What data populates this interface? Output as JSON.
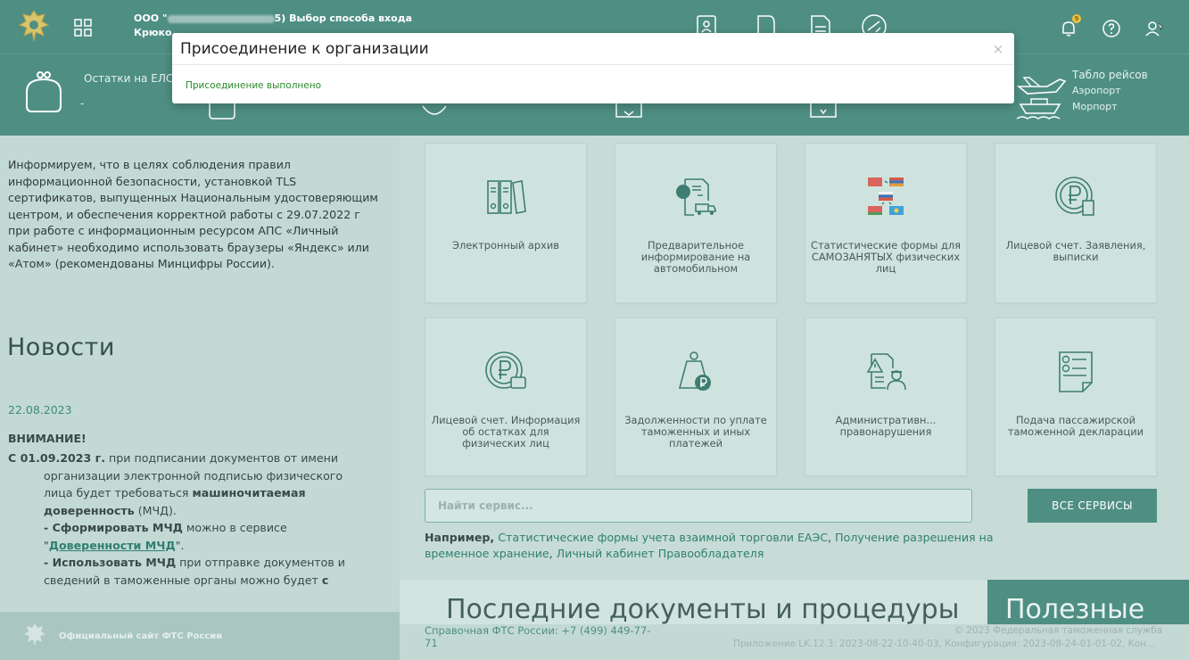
{
  "header": {
    "org_prefix": "ООО \"",
    "org_suffix": "5) Выбор способа входа",
    "user_short": "Крюко",
    "notifications_count": "9"
  },
  "infobar": {
    "balance_label": "Остатки на ЕЛС",
    "balance_value": "-",
    "flights_title": "Табло рейсов",
    "flights_airport": "Аэропорт",
    "flights_seaport": "Морпорт"
  },
  "left": {
    "notice": "Информируем, что в целях соблюдения правил информационной безопасности, установкой TLS сертификатов, выпущенных Национальным удостоверяющим центром, и обеспечения корректной работы с 29.07.2022 г при работе с информационным ресурсом АПС «Личный кабинет» необходимо использовать браузеры «Яндекс» или «Атом» (рекомендованы Минцифры России).",
    "news_title": "Новости",
    "news_date": "22.08.2023",
    "news_head": "ВНИМАНИЕ!",
    "news_p1_bold": "С 01.09.2023 г.",
    "news_p1_text": " при подписании документов от имени",
    "news_p2": "организации электронной подписью физического",
    "news_p3": "лица будет требоваться ",
    "news_p3_bold": "машиночитаемая",
    "news_p4_bold": "доверенность",
    "news_p4_text": " (МЧД).",
    "news_p5_bold": "- Сформировать МЧД",
    "news_p5_text": " можно в сервисе",
    "news_p6_q1": "\"",
    "news_p6_link": "Доверенности МЧД",
    "news_p6_q2": "\".",
    "news_p7_bold": "- Использовать МЧД",
    "news_p7_text": " при отправке документов и",
    "news_p8": "сведений в таможенные органы можно будет ",
    "news_p8_bold": "с",
    "footer_label": "Официальный сайт ФТС России"
  },
  "tiles": [
    {
      "label": "Электронный архив"
    },
    {
      "label": "Предварительное информирование на автомобильном"
    },
    {
      "label": "Статистические формы для САМОЗАНЯТЫХ физических лиц"
    },
    {
      "label": "Лицевой счет. Заявления, выписки"
    },
    {
      "label": "Лицевой счет. Информация об остатках для физических лиц"
    },
    {
      "label": "Задолженности по уплате таможенных и иных платежей"
    },
    {
      "label": "Административн... правонарушения"
    },
    {
      "label": "Подача пассажирской таможенной декларации"
    }
  ],
  "search": {
    "placeholder": "Найти сервис...",
    "all_button": "ВСЕ СЕРВИСЫ",
    "examples_prefix": "Например,",
    "example_1": "Статистические формы учета взаимной торговли ЕАЭС",
    "example_2": "Получение разрешения на временное хранение",
    "example_3": "Личный кабинет Правообладателя",
    "sep": ", "
  },
  "sections": {
    "docs_title": "Последние документы и процедуры",
    "useful_title": "Полезные"
  },
  "footer": {
    "phone_line1": "Справочная ФТС России: +7 (499) 449-77-",
    "phone_line2": "71",
    "copyright": "© 2023 Федеральная таможенная служба",
    "app_info": "Приложение LK.12.3: 2023-08-22-10-40-03, Конфигурация: 2023-08-24-01-01-02, Кон..."
  },
  "modal": {
    "title": "Присоединение к организации",
    "message": "Присоединение выполнено",
    "close": "×"
  },
  "colors": {
    "brand": "#4f8f83",
    "success": "#2a8b2d",
    "link": "#2f7f72"
  }
}
